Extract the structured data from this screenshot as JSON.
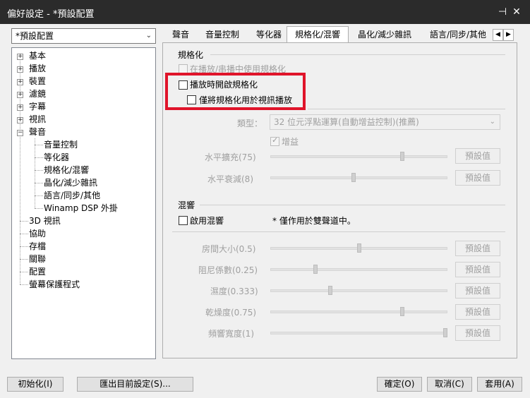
{
  "window": {
    "title": "偏好設定 - *預設配置"
  },
  "profile": {
    "selected": "*預設配置"
  },
  "tree": {
    "items": [
      "基本",
      "播放",
      "裝置",
      "濾鏡",
      "字幕",
      "視訊",
      "聲音"
    ],
    "audio_children": [
      "音量控制",
      "等化器",
      "規格化/混響",
      "晶化/減少雜訊",
      "語言/同步/其他",
      "Winamp DSP 外掛"
    ],
    "more_items": [
      "3D 視訊",
      "協助",
      "存檔",
      "關聯",
      "配置",
      "螢幕保護程式"
    ]
  },
  "tabs": [
    "聲音",
    "音量控制",
    "等化器",
    "規格化/混響",
    "晶化/減少雜訊",
    "語言/同步/其他"
  ],
  "normalize": {
    "group_label": "規格化",
    "cb_partial": "在播放/串播中使用規格化",
    "cb_enable": "播放時開啟規格化",
    "cb_video_only": "僅將規格化用於視訊播放",
    "type_label": "類型：",
    "type_value": "32 位元浮點運算(自動增益控制)(推薦)",
    "gain_label": "增益",
    "sliders": [
      {
        "label": "水平擴充(75)",
        "button": "預設值",
        "value": 75
      },
      {
        "label": "水平衰減(8)",
        "button": "預設值",
        "value": 8
      }
    ]
  },
  "reverb": {
    "group_label": "混響",
    "cb_enable": "啟用混響",
    "note": "* 僅作用於雙聲道中。",
    "sliders": [
      {
        "label": "房間大小(0.5)",
        "button": "預設值",
        "value": 0.5
      },
      {
        "label": "阻尼係數(0.25)",
        "button": "預設值",
        "value": 0.25
      },
      {
        "label": "濕度(0.333)",
        "button": "預設值",
        "value": 0.333
      },
      {
        "label": "乾燥度(0.75)",
        "button": "預設值",
        "value": 0.75
      },
      {
        "label": "頻響寬度(1)",
        "button": "預設值",
        "value": 1
      }
    ]
  },
  "buttons": {
    "init": "初始化(I)",
    "export": "匯出目前設定(S)...",
    "ok": "確定(O)",
    "cancel": "取消(C)",
    "apply": "套用(A)"
  },
  "colors": {
    "titlebar": "#2b2b2b",
    "highlight": "#e0142a"
  }
}
